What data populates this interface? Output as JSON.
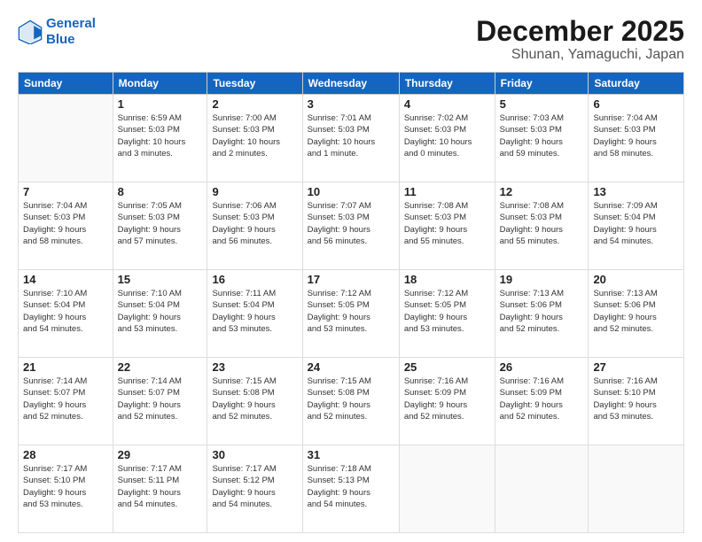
{
  "logo": {
    "line1": "General",
    "line2": "Blue"
  },
  "title": "December 2025",
  "subtitle": "Shunan, Yamaguchi, Japan",
  "weekdays": [
    "Sunday",
    "Monday",
    "Tuesday",
    "Wednesday",
    "Thursday",
    "Friday",
    "Saturday"
  ],
  "weeks": [
    [
      {
        "day": "",
        "info": ""
      },
      {
        "day": "1",
        "info": "Sunrise: 6:59 AM\nSunset: 5:03 PM\nDaylight: 10 hours\nand 3 minutes."
      },
      {
        "day": "2",
        "info": "Sunrise: 7:00 AM\nSunset: 5:03 PM\nDaylight: 10 hours\nand 2 minutes."
      },
      {
        "day": "3",
        "info": "Sunrise: 7:01 AM\nSunset: 5:03 PM\nDaylight: 10 hours\nand 1 minute."
      },
      {
        "day": "4",
        "info": "Sunrise: 7:02 AM\nSunset: 5:03 PM\nDaylight: 10 hours\nand 0 minutes."
      },
      {
        "day": "5",
        "info": "Sunrise: 7:03 AM\nSunset: 5:03 PM\nDaylight: 9 hours\nand 59 minutes."
      },
      {
        "day": "6",
        "info": "Sunrise: 7:04 AM\nSunset: 5:03 PM\nDaylight: 9 hours\nand 58 minutes."
      }
    ],
    [
      {
        "day": "7",
        "info": "Sunrise: 7:04 AM\nSunset: 5:03 PM\nDaylight: 9 hours\nand 58 minutes."
      },
      {
        "day": "8",
        "info": "Sunrise: 7:05 AM\nSunset: 5:03 PM\nDaylight: 9 hours\nand 57 minutes."
      },
      {
        "day": "9",
        "info": "Sunrise: 7:06 AM\nSunset: 5:03 PM\nDaylight: 9 hours\nand 56 minutes."
      },
      {
        "day": "10",
        "info": "Sunrise: 7:07 AM\nSunset: 5:03 PM\nDaylight: 9 hours\nand 56 minutes."
      },
      {
        "day": "11",
        "info": "Sunrise: 7:08 AM\nSunset: 5:03 PM\nDaylight: 9 hours\nand 55 minutes."
      },
      {
        "day": "12",
        "info": "Sunrise: 7:08 AM\nSunset: 5:03 PM\nDaylight: 9 hours\nand 55 minutes."
      },
      {
        "day": "13",
        "info": "Sunrise: 7:09 AM\nSunset: 5:04 PM\nDaylight: 9 hours\nand 54 minutes."
      }
    ],
    [
      {
        "day": "14",
        "info": "Sunrise: 7:10 AM\nSunset: 5:04 PM\nDaylight: 9 hours\nand 54 minutes."
      },
      {
        "day": "15",
        "info": "Sunrise: 7:10 AM\nSunset: 5:04 PM\nDaylight: 9 hours\nand 53 minutes."
      },
      {
        "day": "16",
        "info": "Sunrise: 7:11 AM\nSunset: 5:04 PM\nDaylight: 9 hours\nand 53 minutes."
      },
      {
        "day": "17",
        "info": "Sunrise: 7:12 AM\nSunset: 5:05 PM\nDaylight: 9 hours\nand 53 minutes."
      },
      {
        "day": "18",
        "info": "Sunrise: 7:12 AM\nSunset: 5:05 PM\nDaylight: 9 hours\nand 53 minutes."
      },
      {
        "day": "19",
        "info": "Sunrise: 7:13 AM\nSunset: 5:06 PM\nDaylight: 9 hours\nand 52 minutes."
      },
      {
        "day": "20",
        "info": "Sunrise: 7:13 AM\nSunset: 5:06 PM\nDaylight: 9 hours\nand 52 minutes."
      }
    ],
    [
      {
        "day": "21",
        "info": "Sunrise: 7:14 AM\nSunset: 5:07 PM\nDaylight: 9 hours\nand 52 minutes."
      },
      {
        "day": "22",
        "info": "Sunrise: 7:14 AM\nSunset: 5:07 PM\nDaylight: 9 hours\nand 52 minutes."
      },
      {
        "day": "23",
        "info": "Sunrise: 7:15 AM\nSunset: 5:08 PM\nDaylight: 9 hours\nand 52 minutes."
      },
      {
        "day": "24",
        "info": "Sunrise: 7:15 AM\nSunset: 5:08 PM\nDaylight: 9 hours\nand 52 minutes."
      },
      {
        "day": "25",
        "info": "Sunrise: 7:16 AM\nSunset: 5:09 PM\nDaylight: 9 hours\nand 52 minutes."
      },
      {
        "day": "26",
        "info": "Sunrise: 7:16 AM\nSunset: 5:09 PM\nDaylight: 9 hours\nand 52 minutes."
      },
      {
        "day": "27",
        "info": "Sunrise: 7:16 AM\nSunset: 5:10 PM\nDaylight: 9 hours\nand 53 minutes."
      }
    ],
    [
      {
        "day": "28",
        "info": "Sunrise: 7:17 AM\nSunset: 5:10 PM\nDaylight: 9 hours\nand 53 minutes."
      },
      {
        "day": "29",
        "info": "Sunrise: 7:17 AM\nSunset: 5:11 PM\nDaylight: 9 hours\nand 54 minutes."
      },
      {
        "day": "30",
        "info": "Sunrise: 7:17 AM\nSunset: 5:12 PM\nDaylight: 9 hours\nand 54 minutes."
      },
      {
        "day": "31",
        "info": "Sunrise: 7:18 AM\nSunset: 5:13 PM\nDaylight: 9 hours\nand 54 minutes."
      },
      {
        "day": "",
        "info": ""
      },
      {
        "day": "",
        "info": ""
      },
      {
        "day": "",
        "info": ""
      }
    ]
  ]
}
